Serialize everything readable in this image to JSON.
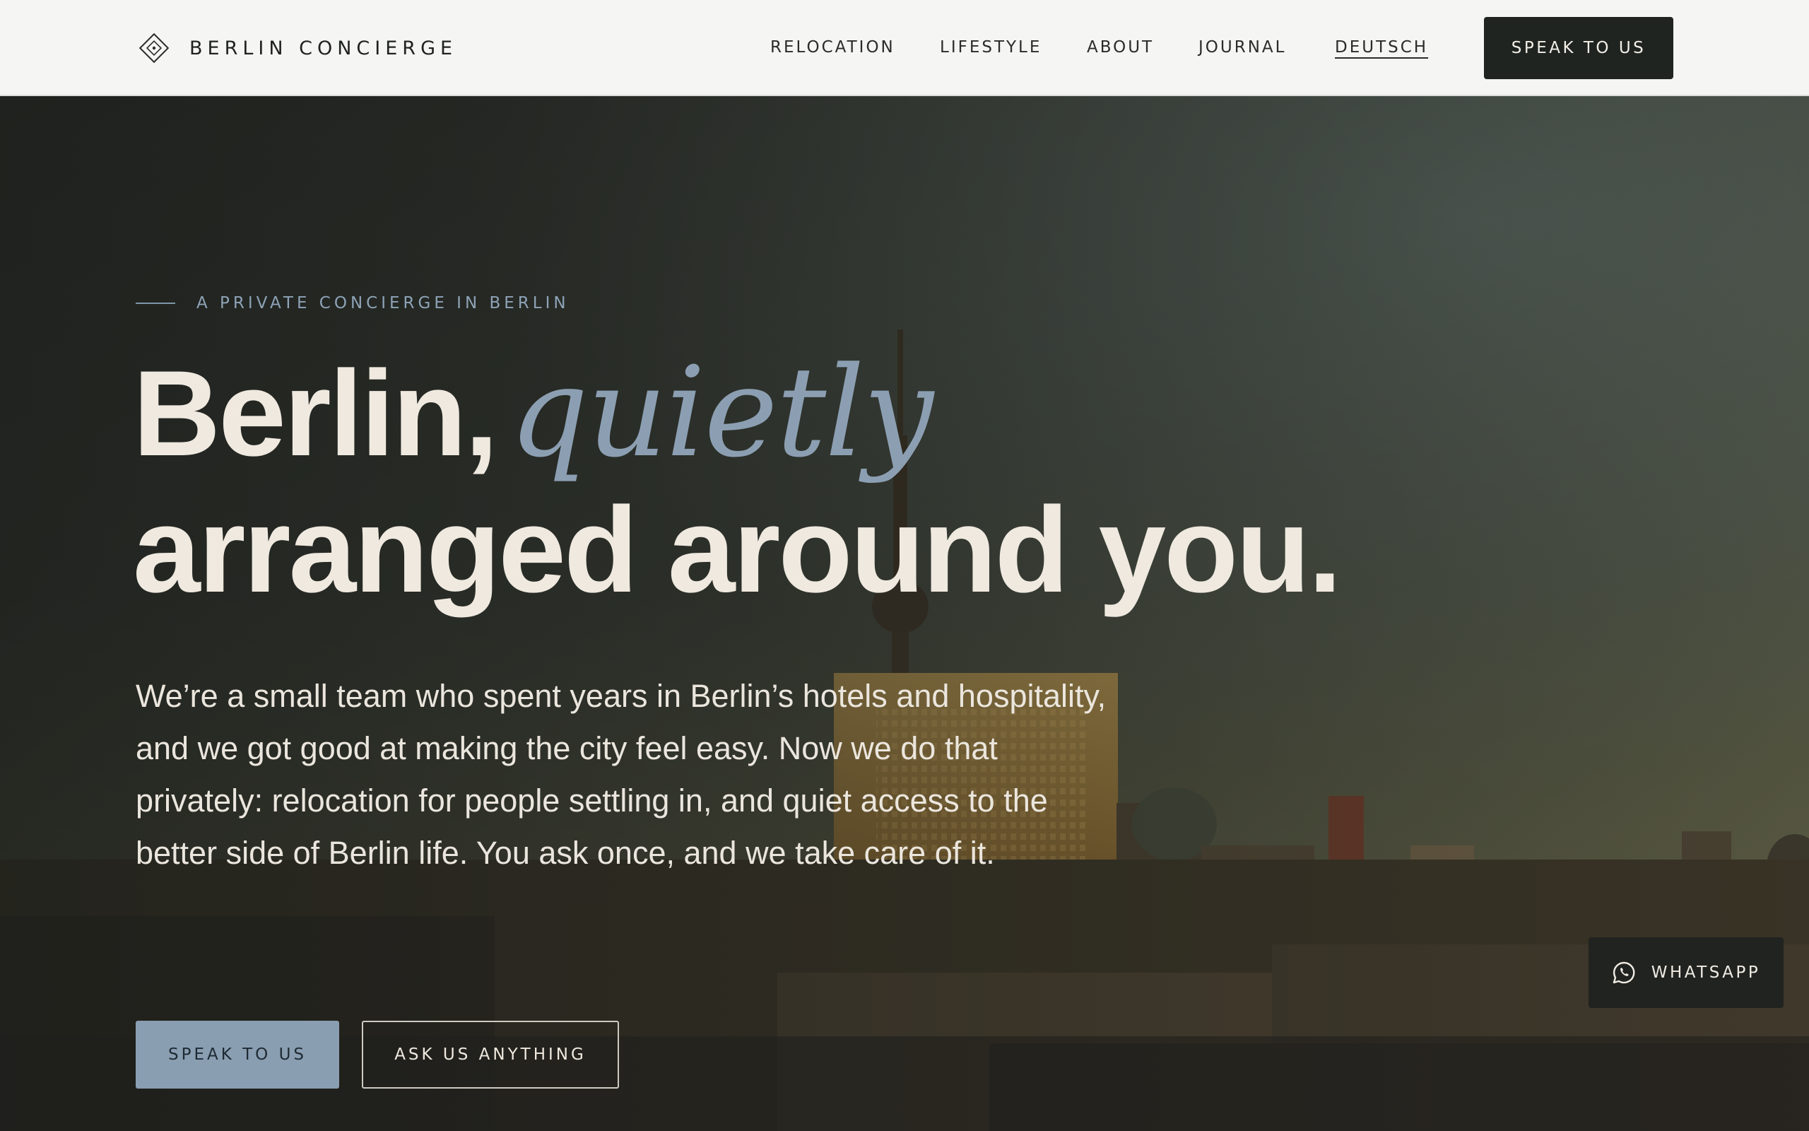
{
  "brand": {
    "name": "BERLIN CONCIERGE",
    "logo_icon": "diamond-logo-icon"
  },
  "nav": {
    "items": [
      {
        "label": "RELOCATION"
      },
      {
        "label": "LIFESTYLE"
      },
      {
        "label": "ABOUT"
      },
      {
        "label": "JOURNAL"
      },
      {
        "label": "DEUTSCH"
      }
    ],
    "cta_label": "SPEAK TO US"
  },
  "hero": {
    "eyebrow": "A PRIVATE CONCIERGE IN BERLIN",
    "headline": {
      "line1_start": "Berlin,",
      "line1_accent": "quietly",
      "line2": "arranged around you."
    },
    "intro": "We’re a small team who spent years in Berlin’s hotels and hospitality, and we got good at making the city feel easy. Now we do that privately: relocation for people settling in, and quiet access to the better side of Berlin life. You ask once, and we take care of it.",
    "primary_cta": "SPEAK TO US",
    "secondary_cta": "ASK US ANYTHING",
    "background": "berlin-skyline-photo"
  },
  "whatsapp": {
    "label": "WHATSAPP",
    "icon": "whatsapp-icon"
  },
  "colors": {
    "accent": "#8a9eb1",
    "header_bg": "#f5f5f4",
    "dark_button": "#1f2421",
    "headline_text": "#efe9df"
  }
}
